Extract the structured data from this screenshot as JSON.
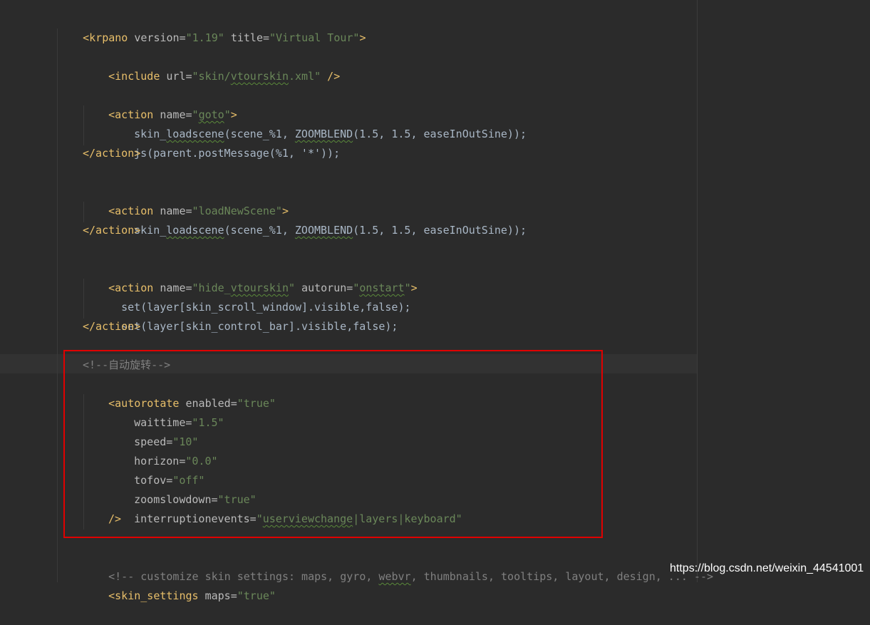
{
  "watermark": "https://blog.csdn.net/weixin_44541001",
  "colors": {
    "background": "#2b2b2b",
    "tag": "#e8bf6a",
    "attribute": "#bababa",
    "string": "#6a8759",
    "comment": "#808080",
    "highlight_box": "#e00000"
  },
  "code": {
    "line1": {
      "open": "<",
      "tag": "krpano",
      "a1": " version=",
      "v1": "\"1.19\"",
      "a2": " title=",
      "v2": "\"Virtual Tour\"",
      "close": ">"
    },
    "line2": {
      "open": "<",
      "tag": "include",
      "a1": " url=",
      "v1a": "\"skin/",
      "v1b": "vtourskin",
      "v1c": ".xml\"",
      "close": " />"
    },
    "line3": {
      "open": "<",
      "tag": "action",
      "a1": " name=",
      "v1a": "\"",
      "v1b": "goto",
      "v1c": "\"",
      "close": ">"
    },
    "line4": {
      "c1": "skin_",
      "c2": "loadscene",
      "c3": "(scene_%1, ",
      "c4": "ZOOMBLEND",
      "c5": "(1.5, 1.5, easeInOutSine));"
    },
    "line5": {
      "c1": "js(parent.postMessage(%1, '*'));"
    },
    "line6": {
      "text": "</action>"
    },
    "line7": {
      "open": "<",
      "tag": "action",
      "a1": " name=",
      "v1": "\"loadNewScene\"",
      "close": ">"
    },
    "line8": {
      "c1": "skin_",
      "c2": "loadscene",
      "c3": "(scene_%1, ",
      "c4": "ZOOMBLEND",
      "c5": "(1.5, 1.5, easeInOutSine));"
    },
    "line9": {
      "text": "</action>"
    },
    "line10": {
      "open": "<",
      "tag": "action",
      "a1": " name=",
      "v1a": "\"hide_",
      "v1b": "vtourskin",
      "v1c": "\"",
      "a2": " autorun=",
      "v2a": "\"",
      "v2b": "onstart",
      "v2c": "\"",
      "close": ">"
    },
    "line11": {
      "c1": "set(layer[skin_scroll_window].visible,false);"
    },
    "line12": {
      "c1": "set(layer[skin_control_bar].visible,false);"
    },
    "line13": {
      "text": "</action>"
    },
    "line14": {
      "text": "<!--自动旋转-->"
    },
    "line15": {
      "open": "<",
      "tag": "autorotate",
      "a1": " enabled=",
      "v1": "\"true\""
    },
    "line16": {
      "a": "waittime=",
      "v": "\"1.5\""
    },
    "line17": {
      "a": "speed=",
      "v": "\"10\""
    },
    "line18": {
      "a": "horizon=",
      "v": "\"0.0\""
    },
    "line19": {
      "a": "tofov=",
      "v": "\"off\""
    },
    "line20": {
      "a": "zoomslowdown=",
      "v": "\"true\""
    },
    "line21": {
      "a": "interruptionevents=",
      "va": "\"",
      "vb": "userviewchange",
      "vc": "|layers|keyboard\""
    },
    "line22": {
      "text": "/>"
    },
    "line23": {
      "c1": "<!-- customize skin settings: maps, gyro, ",
      "c2": "webvr",
      "c3": ", thumbnails, tooltips, layout, design, ... -->"
    },
    "line24": {
      "open": "<",
      "tag": "skin_settings",
      "a1": " maps=",
      "v1": "\"true\""
    }
  }
}
